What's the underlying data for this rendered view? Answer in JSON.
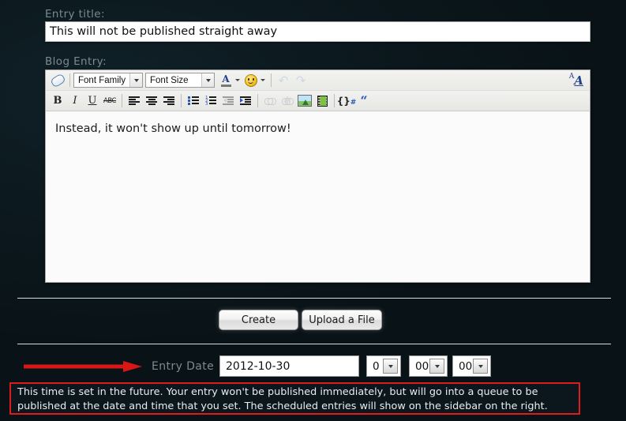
{
  "form": {
    "title_label": "Entry title:",
    "title_value": "This will not be published straight away",
    "body_label": "Blog Entry:",
    "body_text": "Instead, it won't show up until tomorrow!"
  },
  "editor_toolbar": {
    "row1": {
      "cleanup_icon": "eraser-icon",
      "font_family": "Font Family",
      "font_size": "Font Size",
      "forecolor_icon": "text-color-icon",
      "emoticon_icon": "smiley-icon",
      "undo_icon": "undo-icon",
      "redo_icon": "redo-icon",
      "toggle_icon": "toggle-editor-icon"
    },
    "row2": {
      "bold": "B",
      "italic": "I",
      "underline": "U",
      "strikethrough": "ABC",
      "align_left_icon": "align-left-icon",
      "align_center_icon": "align-center-icon",
      "align_right_icon": "align-right-icon",
      "bullet_list_icon": "bullet-list-icon",
      "numbered_list_icon": "numbered-list-icon",
      "outdent_icon": "outdent-icon",
      "indent_icon": "indent-icon",
      "link_icon": "link-icon",
      "unlink_icon": "unlink-icon",
      "image_icon": "insert-image-icon",
      "media_icon": "insert-media-icon",
      "code_icon": "insert-code-icon",
      "quote_icon": "blockquote-icon"
    }
  },
  "actions": {
    "create_label": "Create",
    "upload_label": "Upload a File"
  },
  "schedule": {
    "date_label": "Entry Date",
    "date_value": "2012-10-30",
    "hour_value": "0",
    "minute_value": "00",
    "second_value": "00"
  },
  "warning": {
    "text": "This time is set in the future. Your entry won't be published immediately, but will go into a queue to be published at the date and time that you set. The scheduled entries will show on the sidebar on the right.",
    "border_color": "#e01b1b"
  },
  "theme": {
    "background": "#0b171c",
    "label_color": "#7b8a90",
    "arrow_color": "#d81616",
    "divider_color": "#d4d9db"
  }
}
